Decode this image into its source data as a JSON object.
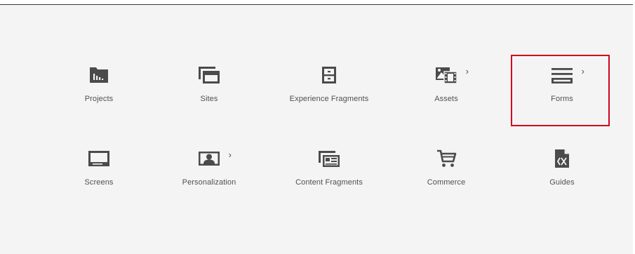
{
  "tiles": [
    {
      "label": "Projects",
      "icon": "projects-folder-icon",
      "has_children": false
    },
    {
      "label": "Sites",
      "icon": "sites-windows-icon",
      "has_children": false
    },
    {
      "label": "Experience Fragments",
      "icon": "experience-fragments-icon",
      "has_children": false
    },
    {
      "label": "Assets",
      "icon": "assets-media-icon",
      "has_children": true
    },
    {
      "label": "Forms",
      "icon": "forms-lines-icon",
      "has_children": true
    },
    {
      "label": "Screens",
      "icon": "screens-monitor-icon",
      "has_children": false
    },
    {
      "label": "Personalization",
      "icon": "personalization-user-icon",
      "has_children": true
    },
    {
      "label": "Content Fragments",
      "icon": "content-fragments-icon",
      "has_children": false
    },
    {
      "label": "Commerce",
      "icon": "commerce-cart-icon",
      "has_children": false
    },
    {
      "label": "Guides",
      "icon": "guides-code-file-icon",
      "has_children": false
    }
  ],
  "chevron": "›",
  "highlighted_tile": "Forms",
  "colors": {
    "icon": "#4b4b4b",
    "text": "#505050",
    "panel": "#f4f4f4",
    "highlight": "#d0021b"
  }
}
